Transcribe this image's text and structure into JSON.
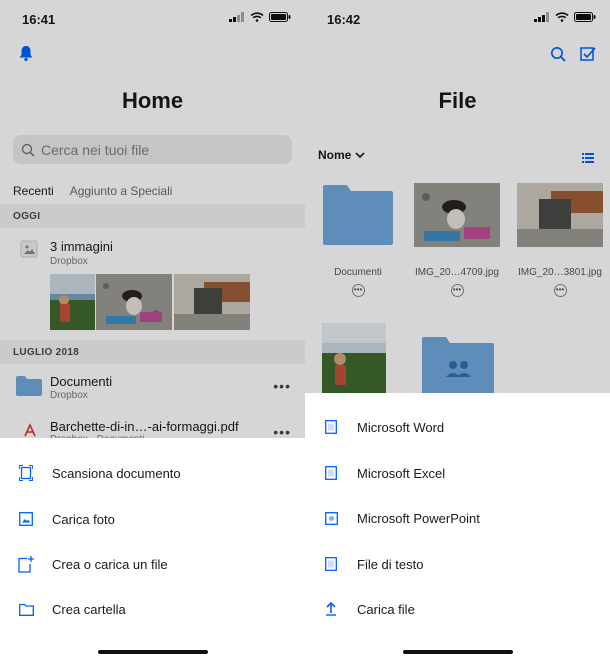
{
  "left": {
    "status": {
      "time": "16:41"
    },
    "title": "Home",
    "search": {
      "placeholder": "Cerca nei tuoi file"
    },
    "tabs": [
      {
        "label": "Recenti"
      },
      {
        "label": "Aggiunto a Speciali"
      }
    ],
    "sections": {
      "today": "OGGI",
      "july": "LUGLIO 2018"
    },
    "recent_group": {
      "title": "3 immagini",
      "subtitle": "Dropbox"
    },
    "files": [
      {
        "name": "Documenti",
        "subtitle": "Dropbox",
        "icon": "folder-icon"
      },
      {
        "name": "Barchette-di-in…-ai-formaggi.pdf",
        "subtitle": "Dropbox · Documenti",
        "icon": "pdf-icon"
      }
    ],
    "sheet": [
      {
        "label": "Scansiona documento",
        "icon": "scan-document-icon"
      },
      {
        "label": "Carica foto",
        "icon": "photo-icon"
      },
      {
        "label": "Crea o carica un file",
        "icon": "new-file-icon"
      },
      {
        "label": "Crea cartella",
        "icon": "folder-outline-icon"
      }
    ]
  },
  "right": {
    "status": {
      "time": "16:42"
    },
    "title": "File",
    "sort": {
      "label": "Nome"
    },
    "grid": [
      {
        "name": "Documenti",
        "kind": "folder"
      },
      {
        "name": "IMG_20…4709.jpg",
        "kind": "image"
      },
      {
        "name": "IMG_20…3801.jpg",
        "kind": "image"
      }
    ],
    "sheet": [
      {
        "label": "Microsoft Word",
        "icon": "word-doc-icon"
      },
      {
        "label": "Microsoft Excel",
        "icon": "excel-doc-icon"
      },
      {
        "label": "Microsoft PowerPoint",
        "icon": "powerpoint-doc-icon"
      },
      {
        "label": "File di testo",
        "icon": "text-file-icon"
      },
      {
        "label": "Carica file",
        "icon": "upload-icon"
      }
    ]
  },
  "colors": {
    "accent": "#0061fe",
    "folder": "#6fa8dc",
    "dim_overlay": "rgba(0,0,0,0.16)"
  }
}
